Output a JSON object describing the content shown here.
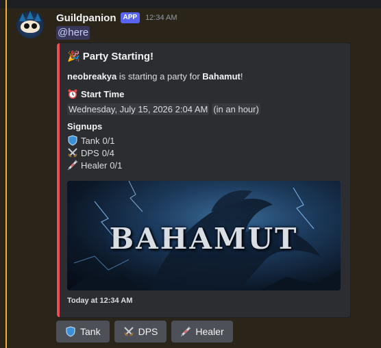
{
  "message": {
    "username": "Guildpanion",
    "badge": "APP",
    "timestamp": "12:34 AM",
    "mention": "@here"
  },
  "embed": {
    "title_emoji": "🎉",
    "title": "Party Starting!",
    "description": {
      "organizer": "neobreakya",
      "middle": " is starting a party for ",
      "target": "Bahamut",
      "end": "!"
    },
    "start_time": {
      "label": "Start Time",
      "value": "Wednesday, July 15, 2026 2:04 AM",
      "relative": "in an hour"
    },
    "signups": {
      "label": "Signups",
      "items": [
        {
          "role": "Tank",
          "count": "0/1",
          "icon": "shield-icon"
        },
        {
          "role": "DPS",
          "count": "0/4",
          "icon": "crossed-swords-icon"
        },
        {
          "role": "Healer",
          "count": "0/1",
          "icon": "syringe-icon"
        }
      ]
    },
    "image": {
      "banner_text": "BAHAMUT"
    },
    "footer_timestamp": "Today at 12:34 AM",
    "accent_color": "#f04c58"
  },
  "buttons": [
    {
      "label": "Tank",
      "icon": "shield-icon"
    },
    {
      "label": "DPS",
      "icon": "crossed-swords-icon"
    },
    {
      "label": "Healer",
      "icon": "syringe-icon"
    }
  ]
}
